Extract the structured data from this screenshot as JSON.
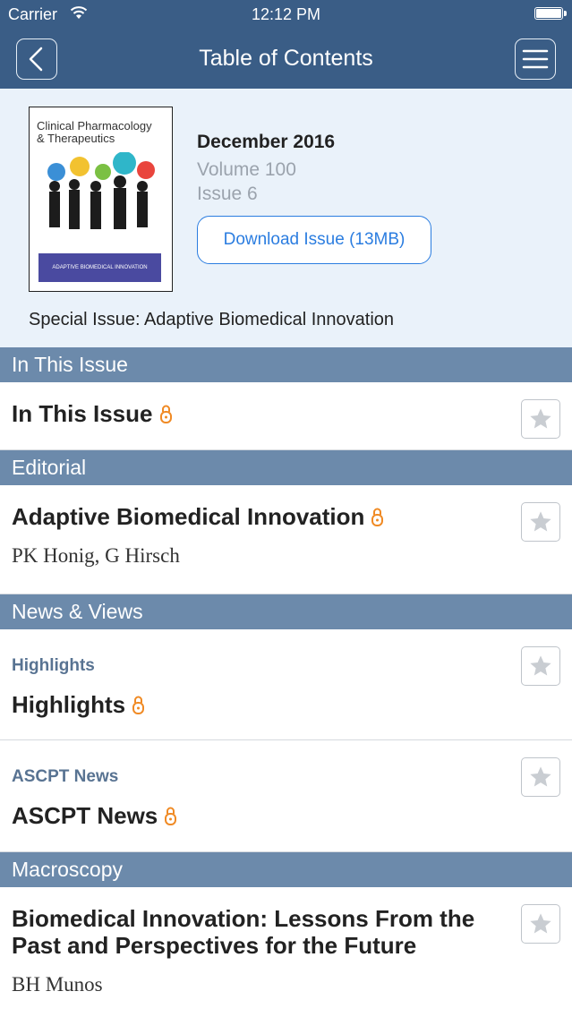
{
  "status_bar": {
    "carrier": "Carrier",
    "time": "12:12 PM"
  },
  "nav": {
    "title": "Table of Contents"
  },
  "issue": {
    "date": "December 2016",
    "volume": "Volume 100",
    "issue": "Issue 6",
    "download_label": "Download Issue (13MB)",
    "special": "Special Issue: Adaptive Biomedical Innovation",
    "cover_title": "Clinical Pharmacology & Therapeutics",
    "cover_band": "ADAPTIVE BIOMEDICAL INNOVATION"
  },
  "sections": [
    {
      "title": "In This Issue"
    },
    {
      "title": "Editorial"
    },
    {
      "title": "News & Views"
    },
    {
      "title": "Macroscopy"
    }
  ],
  "articles": [
    {
      "title": "In This Issue"
    },
    {
      "title": "Adaptive Biomedical Innovation",
      "authors": "PK Honig, G Hirsch"
    },
    {
      "category": "Highlights",
      "title": "Highlights"
    },
    {
      "category": "ASCPT News",
      "title": "ASCPT News"
    },
    {
      "title": "Biomedical Innovation: Lessons From the Past and Perspectives for the Future",
      "authors": "BH Munos"
    }
  ],
  "colors": {
    "nav_bg": "#3a5d86",
    "section_bg": "#6c8aab",
    "link_blue": "#2b7de0",
    "lock_orange": "#f08a24",
    "header_bg": "#eaf2fa"
  },
  "icons": [
    "wifi-icon",
    "battery-icon",
    "back-icon",
    "menu-icon",
    "lock-icon",
    "star-icon"
  ]
}
